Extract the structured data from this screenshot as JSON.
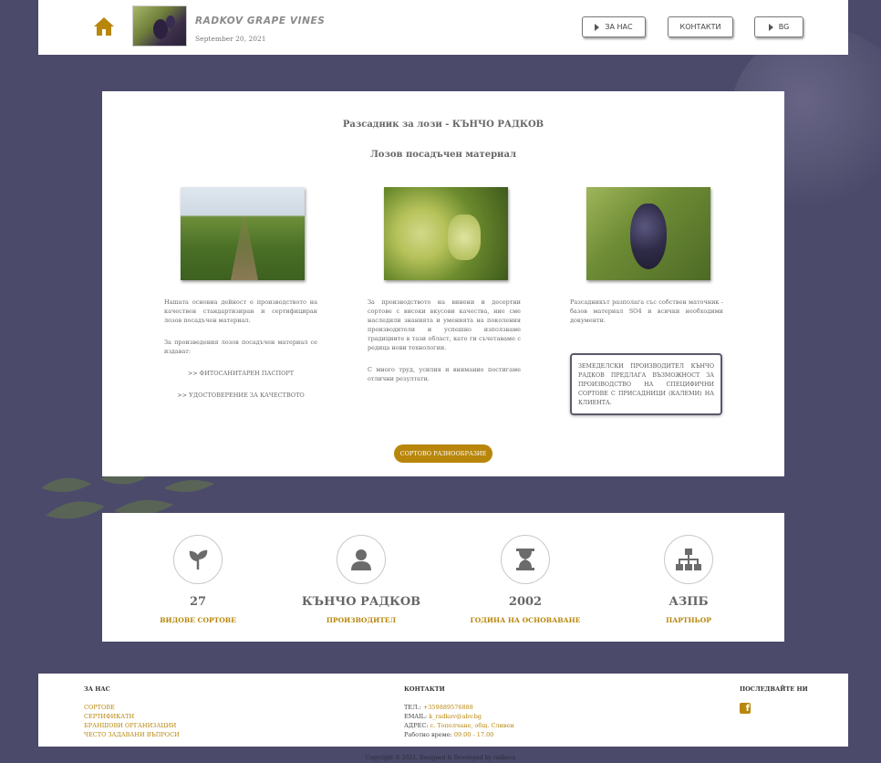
{
  "header": {
    "site_title": "RADKOV GRAPE VINES",
    "date": "September 20, 2021",
    "nav": {
      "about": "ЗА НАС",
      "contacts": "КОНТАКТИ",
      "lang": "BG"
    }
  },
  "main": {
    "title": "Разсадник за лози - КЪНЧО РАДКОВ",
    "subtitle": "Лозов посадъчен материал",
    "col1": {
      "p1": "Нашата основна дейност е производството на качествен стандартизиран и сертифициран лозов посадъчен материал.",
      "p2": "За произведения лозов посадъчен материал се издават:",
      "link1": ">> ФИТОСАНИТАРЕН ПАСПОРТ",
      "link2": ">> УДОСТОВЕРЕНИЕ ЗА КАЧЕСТВОТО"
    },
    "col2": {
      "p1": "За производството на винени и десертни сортове с високи вкусови качества, ние сме наследили знанията и уменията на поколения производители и успешно използваме традициите в тази област, като ги съчетаваме с редица нови технологии.",
      "p2": "С много труд, усилия и внимание постигаме отлични резултати."
    },
    "col3": {
      "p1": "Разсадникът разполага със собствен маточник - базов материал SO4 и всички необходими документи.",
      "notice": "ЗЕМЕДЕЛСКИ ПРОИЗВОДИТЕЛ КЪНЧО РАДКОВ ПРЕДЛАГА ВЪЗМОЖНОСТ ЗА ПРОИЗВОДСТВО НА СПЕЦИФИЧНИ СОРТОВЕ С ПРИСАДНИЦИ (КАЛЕМИ) НА КЛИЕНТА."
    },
    "button": "СОРТОВО РАЗНООБРАЗИЕ"
  },
  "stats": [
    {
      "value": "27",
      "label": "ВИДОВЕ СОРТОВЕ",
      "icon": "seedling-icon"
    },
    {
      "value": "КЪНЧО РАДКОВ",
      "label": "ПРОИЗВОДИТЕЛ",
      "icon": "user-icon"
    },
    {
      "value": "2002",
      "label": "ГОДИНА НА ОСНОВАВАНЕ",
      "icon": "hourglass-icon"
    },
    {
      "value": "АЗПБ",
      "label": "ПАРТНЬОР",
      "icon": "sitemap-icon"
    }
  ],
  "footer": {
    "about_head": "ЗА НАС",
    "links": [
      "СОРТОВЕ",
      "СЕРТИФИКАТИ",
      "БРАНШОВИ ОРГАНИЗАЦИИ",
      "ЧЕСТО ЗАДАВАНИ ВЪПРОСИ"
    ],
    "contacts_head": "КОНТАКТИ",
    "phone_label": "ТЕЛ.:",
    "phone": "+359889576888",
    "email_label": "EMAIL:",
    "email": "k_radkov@abv.bg",
    "address_label": "АДРЕС:",
    "address": "с. Тополчане, общ. Сливен",
    "hours_label": "Работно време:",
    "hours": "09.00 - 17.00",
    "follow_head": "ПОСЛЕДВАЙТЕ НИ",
    "copyright": "Copyright © 2021, Designed & Developed by radkova"
  },
  "colors": {
    "accent": "#b8860b",
    "background": "#4b4a6a"
  }
}
